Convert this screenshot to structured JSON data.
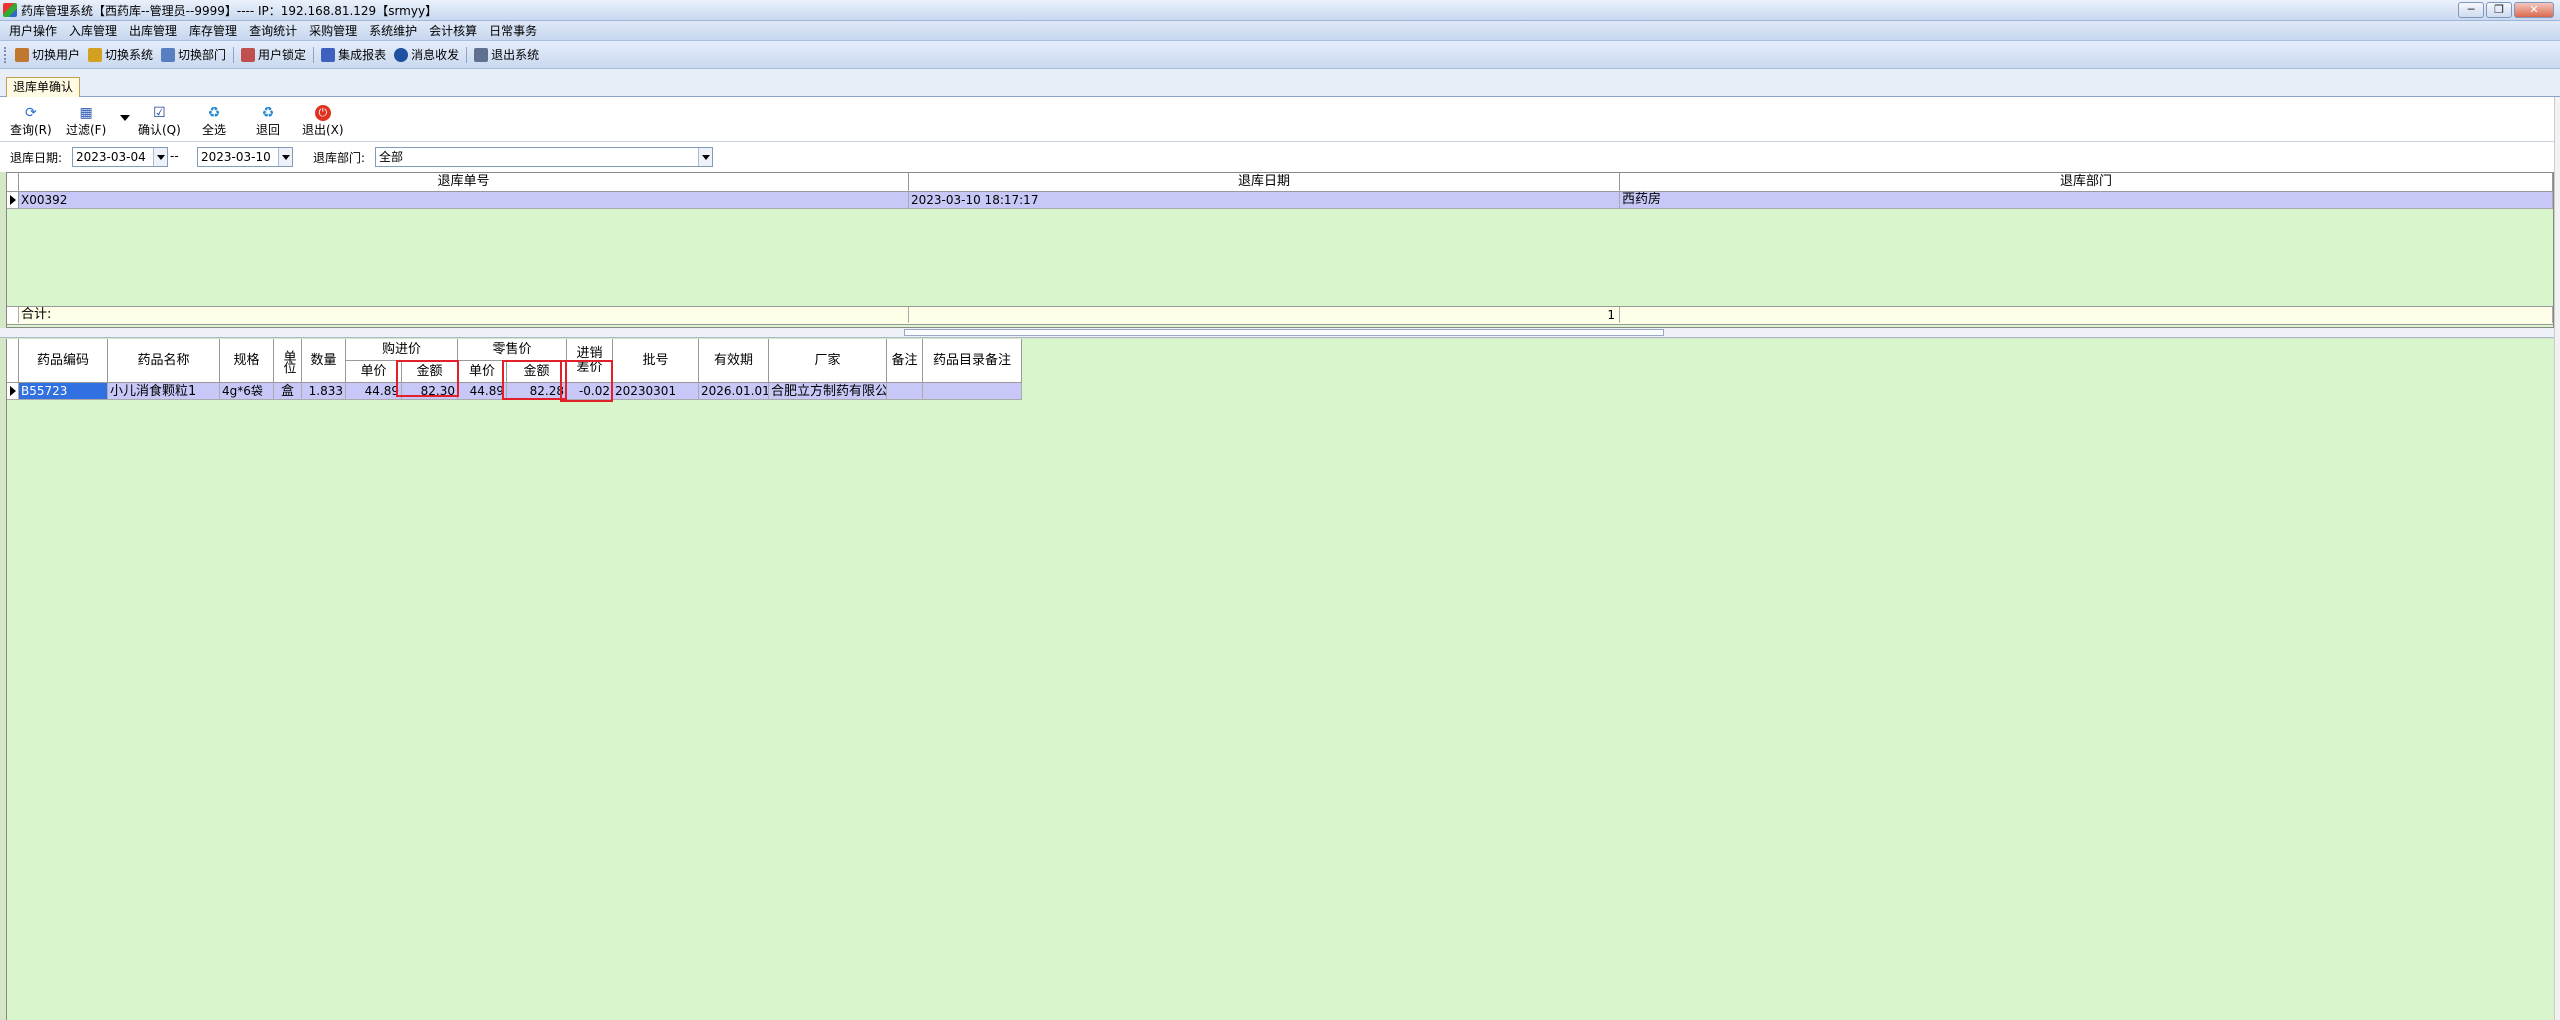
{
  "window": {
    "title": "药库管理系统【西药库--管理员--9999】---- IP：192.168.81.129【srmyy】",
    "controls": {
      "minimize": "─",
      "restore": "❐",
      "close": "✕"
    }
  },
  "menu": [
    "用户操作",
    "入库管理",
    "出库管理",
    "库存管理",
    "查询统计",
    "采购管理",
    "系统维护",
    "会计核算",
    "日常事务"
  ],
  "quickbar": [
    {
      "label": "切换用户",
      "icon": "users-icon",
      "color": "#c07830"
    },
    {
      "label": "切换系统",
      "icon": "switch-system-icon",
      "color": "#d4a020"
    },
    {
      "label": "切换部门",
      "icon": "department-icon",
      "color": "#5a7fc0"
    },
    {
      "label": "用户锁定",
      "icon": "lock-user-icon",
      "color": "#c05050"
    },
    {
      "label": "集成报表",
      "icon": "report-icon",
      "color": "#4060c0"
    },
    {
      "label": "消息收发",
      "icon": "info-icon",
      "color": "#2050a0"
    },
    {
      "label": "退出系统",
      "icon": "exit-icon",
      "color": "#607090"
    }
  ],
  "tab": {
    "label": "退库单确认"
  },
  "actions": {
    "query": "查询(R)",
    "filter": "过滤(F)",
    "confirm": "确认(Q)",
    "select_all": "全选",
    "return": "退回",
    "exit": "退出(X)"
  },
  "filters": {
    "date_label": "退库日期:",
    "date_from": "2023-03-04",
    "date_sep": "--",
    "date_to": "2023-03-10",
    "dept_label": "退库部门:",
    "dept_value": "全部"
  },
  "master": {
    "columns": [
      "退库单号",
      "退库日期",
      "退库部门"
    ],
    "row": {
      "number": "X00392",
      "date": "2023-03-10 18:17:17",
      "dept": "西药房"
    },
    "total_label": "合计:",
    "total_count": "1"
  },
  "detail": {
    "headers": {
      "code": "药品编码",
      "name": "药品名称",
      "spec": "规格",
      "unit": "单位",
      "qty": "数量",
      "purchase_group": "购进价",
      "retail_group": "零售价",
      "unit_price": "单价",
      "amount": "金额",
      "diff": "进销差价",
      "batch": "批号",
      "expiry": "有效期",
      "maker": "厂家",
      "note": "备注",
      "catalog_note": "药品目录备注"
    },
    "row": {
      "code": "B55723",
      "name": "小儿消食颗粒1",
      "spec": "4g*6袋",
      "unit": "盒",
      "qty": "1.833",
      "purchase_price": "44.89",
      "purchase_amount": "82.30",
      "retail_price": "44.89",
      "retail_amount": "82.28",
      "diff": "-0.02",
      "batch": "20230301",
      "expiry": "2026.01.01",
      "maker": "合肥立方制药有限公司",
      "note": "",
      "catalog_note": ""
    }
  },
  "colors": {
    "grid_bg": "#d9f5cc",
    "row_bg": "#c8c8f8",
    "highlight": "#e2202a",
    "selected": "#3070e0"
  }
}
